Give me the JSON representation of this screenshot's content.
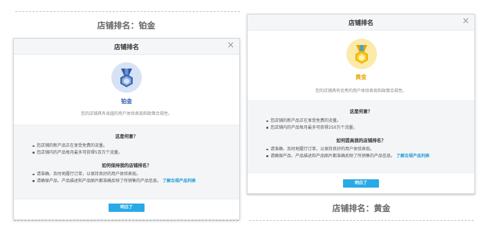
{
  "left": {
    "caption": "店铺排名：铂金",
    "dialog": {
      "title": "店铺排名",
      "close": "×",
      "tier_name": "铂金",
      "tier_color": "#2f5fb3",
      "description": "您的店铺具有卓越的用户体验表现和政策合规性。",
      "what_heading": "这是何意？",
      "what_items": [
        "您店铺的新产品正在享受免费的流量。",
        "您店铺内的产品每月最多可获得5百万个流量。"
      ],
      "keep_heading": "如何保持我的店铺排名？",
      "keep_items": [
        "请准确、及时地履行订单，以保持良好的用户体验表现。",
        "请确保产品、产品描述和产品图片都准确反映了所销售的产品信息。"
      ],
      "link": "了解合规产品列表",
      "button": "明白了"
    }
  },
  "right": {
    "caption": "店铺排名：黄金",
    "dialog": {
      "title": "店铺排名",
      "close": "×",
      "tier_name": "黄金",
      "tier_color": "#e8a800",
      "description": "您的店铺具有优秀的用户体验表现和政策合规性。",
      "what_heading": "这是何意？",
      "what_items": [
        "您店铺的新产品正在享受免费的流量。",
        "您店铺内的产品每月最多可获得250万个流量。"
      ],
      "keep_heading": "如何提高我的店铺排名？",
      "keep_items": [
        "请准确、及时地履行订单，以保持良好的用户体验表现。",
        "请确保产品、产品描述和产品图片都准确反映了所销售的产品信息。"
      ],
      "link": "了解合规产品列表",
      "button": "明白了"
    }
  }
}
